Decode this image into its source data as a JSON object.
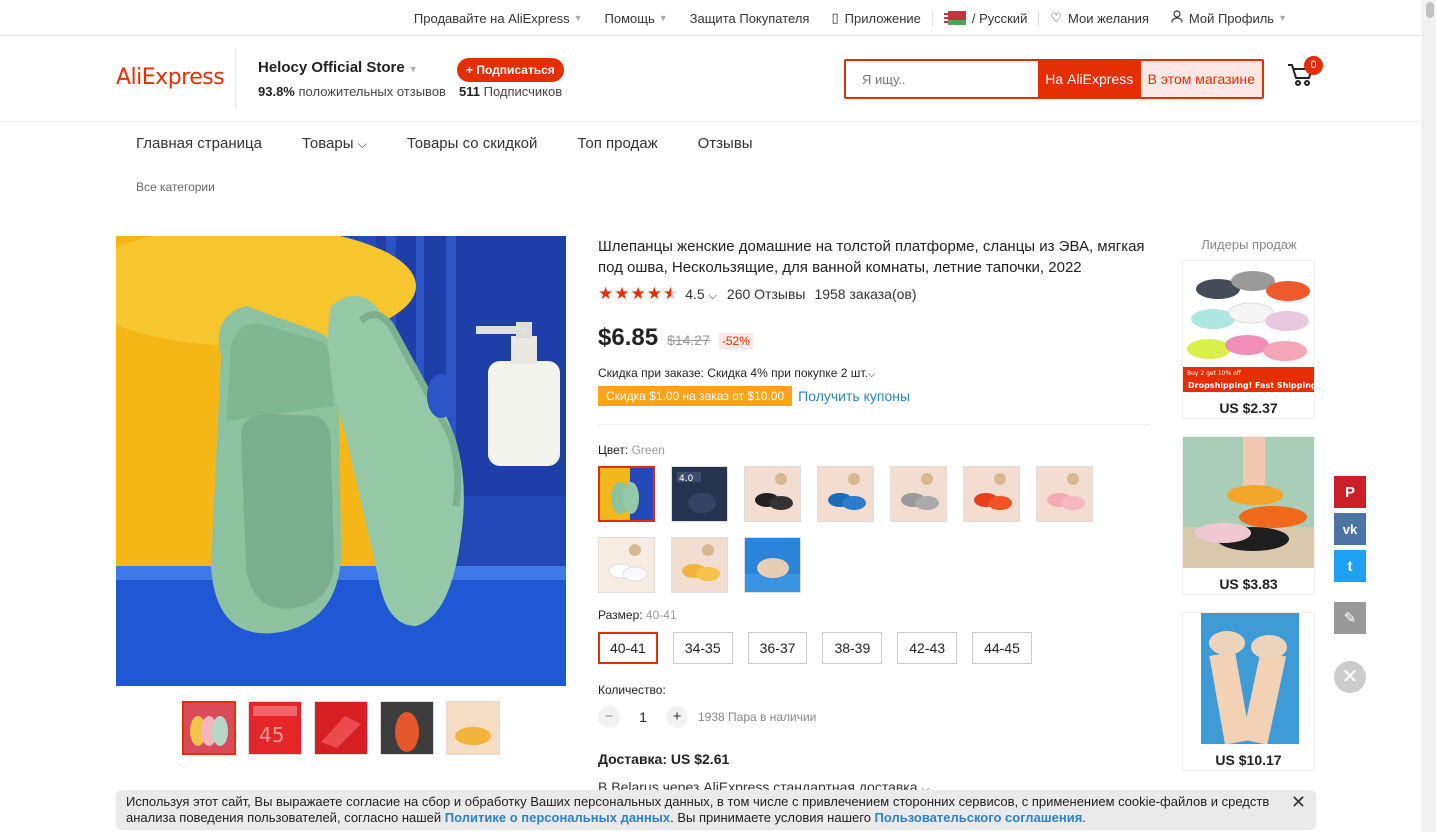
{
  "topbar": {
    "sell": "Продавайте на AliExpress",
    "help": "Помощь",
    "protection": "Защита Покупателя",
    "app": "Приложение",
    "language": "/ Русский",
    "wishlist": "Мои желания",
    "profile": "Мой Профиль"
  },
  "header": {
    "logo": "AliExpress",
    "store_name": "Helocy Official Store",
    "positive_pct": "93.8%",
    "positive_label": "положительных отзывов",
    "subscribe": "+ Подписаться",
    "followers_count": "511",
    "followers_label": "Подписчиков",
    "search_placeholder": "Я ищу..",
    "search_all": "На AliExpress",
    "search_store": "В этом магазине",
    "cart_count": "0"
  },
  "storenav": {
    "home": "Главная страница",
    "products": "Товары",
    "sale": "Товары со скидкой",
    "top": "Топ продаж",
    "reviews": "Отзывы",
    "all_categories": "Все категории"
  },
  "product": {
    "title": "Шлепанцы женские домашние на толстой платформе, сланцы из ЭВА, мягкая под ошва, Нескользящие, для ванной комнаты, летние тапочки, 2022",
    "rating": "4.5",
    "rating_value": 4.5,
    "reviews": "260 Отзывы",
    "orders": "1958 заказа(ов)",
    "price": "$6.85",
    "old_price": "$14.27",
    "discount": "-52%",
    "order_discount": "Скидка при заказе: Скидка 4% при покупке 2 шт.",
    "coupon": "Скидка $1.00 на заказ от $10.00",
    "get_coupons": "Получить купоны",
    "color_label": "Цвет:",
    "color_value": "Green",
    "size_label": "Размер:",
    "size_value": "40-41",
    "sizes": [
      "40-41",
      "34-35",
      "36-37",
      "38-39",
      "42-43",
      "44-45"
    ],
    "qty_label": "Количество:",
    "qty": "1",
    "stock": "1938 Пара в наличии",
    "shipping": "Доставка: US $2.61",
    "shipping_detail": "В Belarus через AliExpress стандартная доставка",
    "swatch_colors": [
      "green",
      "navy",
      "black",
      "blue",
      "grey",
      "orange",
      "pink",
      "white",
      "yellow",
      "beige"
    ]
  },
  "bestsellers": {
    "title": "Лидеры продаж",
    "items": [
      {
        "price": "US $2.37",
        "banner_top": "Buy 2 get 10% off",
        "banner": "Dropshipping! Fast Shipping!"
      },
      {
        "price": "US $3.83"
      },
      {
        "price": "US $10.17"
      }
    ]
  },
  "share": {
    "pinterest": "P",
    "vk": "vk",
    "twitter": "t"
  },
  "cookie": {
    "text1": "Используя этот сайт, Вы выражаете согласие на сбор и обработку Ваших персональных данных, в том числе с привлечением сторонних сервисов, с применением cookie-файлов и средств анализа поведения пользователей, согласно нашей ",
    "link1": "Политике о персональных данных",
    "text2": ". Вы принимаете условия нашего ",
    "link2": "Пользовательского соглашения",
    "text3": "."
  },
  "colors": {
    "accent": "#e62e04",
    "link": "#2e83c6",
    "coupon": "#ffa31a"
  }
}
